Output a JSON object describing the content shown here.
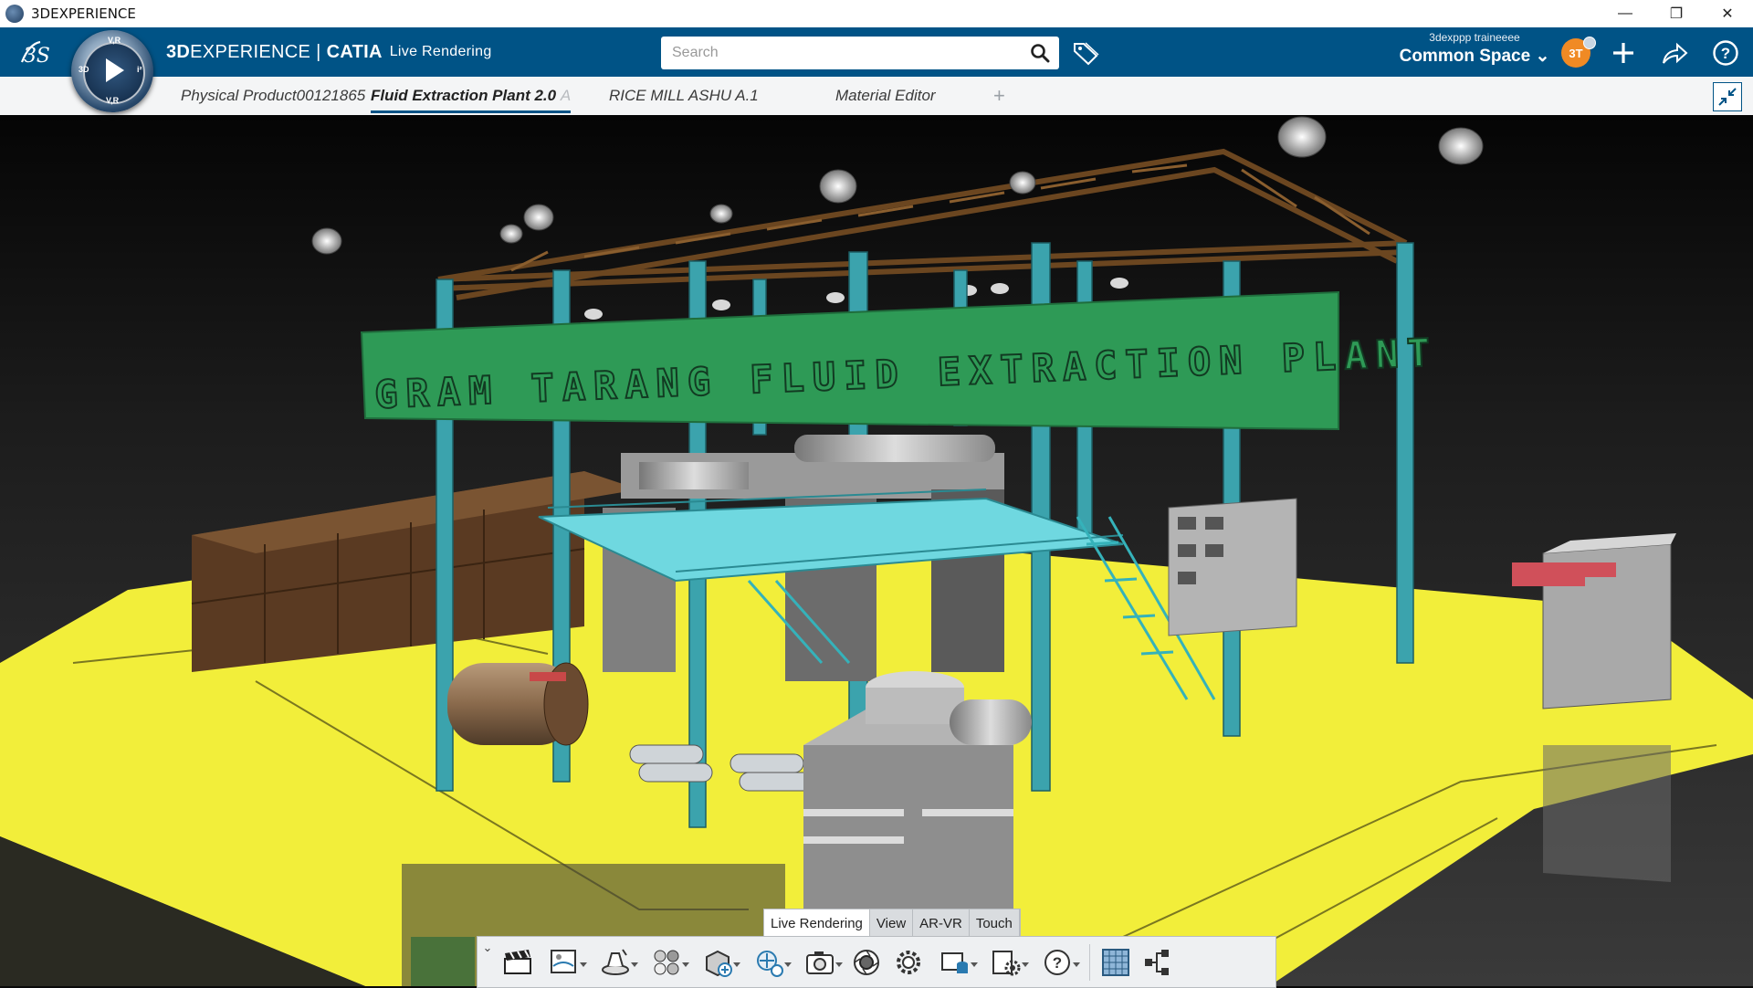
{
  "window": {
    "title": "3DEXPERIENCE",
    "minimize_icon": "minimize-icon",
    "restore_icon": "restore-icon",
    "close_icon": "close-icon",
    "minimize_glyph": "—",
    "restore_glyph": "❐",
    "close_glyph": "✕"
  },
  "header": {
    "brand_3d": "3D",
    "brand_experience": "EXPERIENCE",
    "brand_separator": "|",
    "brand_catia": "CATIA",
    "brand_app": "Live Rendering",
    "compass_labels": {
      "top": "V,R",
      "left": "3D",
      "right": "i²",
      "bottom": "V,R"
    },
    "search": {
      "placeholder": "Search",
      "value": ""
    },
    "user_name": "3dexppp traineeee",
    "space_label": "Common Space ⌄",
    "avatar_initials": "3T",
    "accent_color": "#005386",
    "avatar_color": "#f08a24"
  },
  "tabs": [
    {
      "label": "Physical Product00121865",
      "active": false
    },
    {
      "label": "Fluid Extraction Plant 2.0",
      "suffix": "A",
      "active": true
    },
    {
      "label": "RICE MILL ASHU A.1",
      "active": false
    },
    {
      "label": "Material Editor",
      "active": false
    }
  ],
  "tab_add_label": "+",
  "scene": {
    "banner_text": "GRAM TARANG FLUID EXTRACTION PLANT",
    "banner_color": "#2e9a56",
    "floor_color": "#f2ee3a",
    "steel_color": "#3ba3ad",
    "truss_color": "#5a3a1c"
  },
  "action_tabs": [
    {
      "label": "Live Rendering",
      "active": true
    },
    {
      "label": "View",
      "active": false
    },
    {
      "label": "AR-VR",
      "active": false
    },
    {
      "label": "Touch",
      "active": false
    }
  ],
  "action_bar": {
    "collapse_glyph": "⌄",
    "tools": [
      {
        "icon": "clapperboard-icon",
        "dropdown": false
      },
      {
        "icon": "environment-icon",
        "dropdown": true
      },
      {
        "icon": "studio-lights-icon",
        "dropdown": true
      },
      {
        "icon": "materials-icon",
        "dropdown": true
      },
      {
        "icon": "add-object-icon",
        "dropdown": true
      },
      {
        "icon": "add-light-icon",
        "dropdown": true
      },
      {
        "icon": "capture-camera-icon",
        "dropdown": true
      },
      {
        "icon": "lens-icon",
        "dropdown": false
      },
      {
        "icon": "settings-gear-icon",
        "dropdown": false
      },
      {
        "icon": "render-database-icon",
        "dropdown": true
      },
      {
        "icon": "render-settings-icon",
        "dropdown": true
      },
      {
        "icon": "help-icon",
        "dropdown": true
      },
      {
        "icon": "ground-grid-icon",
        "dropdown": false
      },
      {
        "icon": "tree-structure-icon",
        "dropdown": false
      }
    ]
  }
}
